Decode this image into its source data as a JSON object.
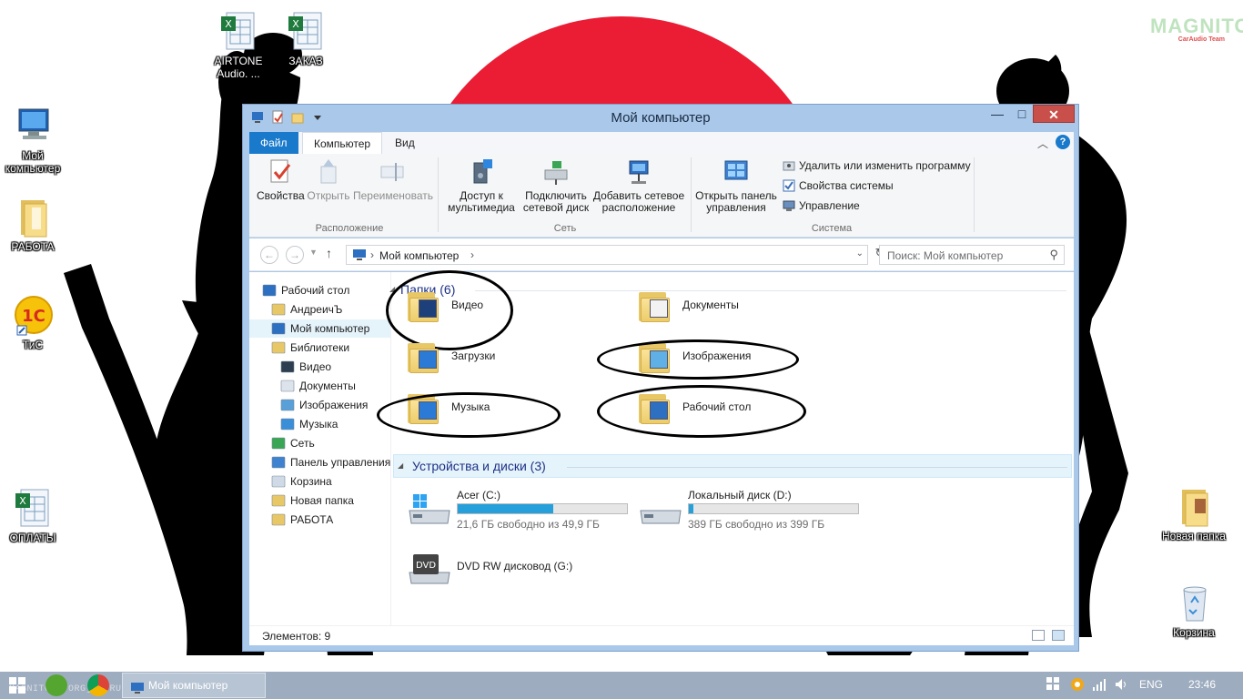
{
  "desktop": {
    "icons": [
      {
        "label": "AIRTONE\nAudio. ...",
        "icon": "excel-file-icon"
      },
      {
        "label": "ЗАКАЗ",
        "icon": "excel-file-icon"
      },
      {
        "label": "Мой\nкомпьютер",
        "icon": "computer-icon"
      },
      {
        "label": "РАБОТА",
        "icon": "folder-icon"
      },
      {
        "label": "ТиС",
        "icon": "1c-icon"
      },
      {
        "label": "ОПЛАТЫ",
        "icon": "excel-file-icon"
      },
      {
        "label": "Новая папка",
        "icon": "folder-icon"
      },
      {
        "label": "Корзина",
        "icon": "recycle-bin-icon"
      }
    ],
    "logo": {
      "main": "MAGNITOLA",
      "sub": "CarAudio Team"
    },
    "wallpaper_colors": {
      "sun": "#ea1d35",
      "silhouette": "#000000"
    }
  },
  "window": {
    "title": "Мой компьютер",
    "controls": {
      "minimize": "—",
      "maximize": "□",
      "close": "✕"
    },
    "ribbon": {
      "tabs": [
        "Файл",
        "Компьютер",
        "Вид"
      ],
      "groups": [
        {
          "label": "Расположение",
          "buttons": [
            "Свойства",
            "Открыть",
            "Переименовать"
          ]
        },
        {
          "label": "Сеть",
          "buttons": [
            "Доступ к\nмультимедиа",
            "Подключить\nсетевой диск",
            "Добавить сетевое\nрасположение"
          ]
        },
        {
          "label": "Система",
          "buttons": [
            "Открыть панель\nуправления"
          ],
          "small": [
            "Удалить или изменить программу",
            "Свойства системы",
            "Управление"
          ]
        }
      ]
    },
    "address": {
      "crumbs": [
        "Мой компьютер"
      ],
      "search_placeholder": "Поиск: Мой компьютер"
    },
    "nav_pane": [
      {
        "label": "Рабочий стол",
        "icon": "desktop-icon",
        "level": 0
      },
      {
        "label": "АндреичЪ",
        "icon": "user-folder-icon",
        "level": 1
      },
      {
        "label": "Мой компьютер",
        "icon": "computer-icon",
        "level": 1,
        "selected": true
      },
      {
        "label": "Библиотеки",
        "icon": "libraries-icon",
        "level": 1
      },
      {
        "label": "Видео",
        "icon": "video-icon",
        "level": 2
      },
      {
        "label": "Документы",
        "icon": "documents-icon",
        "level": 2
      },
      {
        "label": "Изображения",
        "icon": "pictures-icon",
        "level": 2
      },
      {
        "label": "Музыка",
        "icon": "music-icon",
        "level": 2
      },
      {
        "label": "Сеть",
        "icon": "network-icon",
        "level": 1
      },
      {
        "label": "Панель управления",
        "icon": "control-panel-icon",
        "level": 1
      },
      {
        "label": "Корзина",
        "icon": "recycle-bin-icon",
        "level": 1
      },
      {
        "label": "Новая папка",
        "icon": "folder-icon",
        "level": 1
      },
      {
        "label": "РАБОТА",
        "icon": "folder-icon",
        "level": 1
      }
    ],
    "folders_header": "Папки (6)",
    "folders": [
      {
        "name": "Видео",
        "icon": "video-folder-icon",
        "circled": true
      },
      {
        "name": "Документы",
        "icon": "documents-folder-icon",
        "circled": false
      },
      {
        "name": "Загрузки",
        "icon": "downloads-folder-icon",
        "circled": false
      },
      {
        "name": "Изображения",
        "icon": "pictures-folder-icon",
        "circled": true
      },
      {
        "name": "Музыка",
        "icon": "music-folder-icon",
        "circled": true
      },
      {
        "name": "Рабочий стол",
        "icon": "desktop-folder-icon",
        "circled": true
      }
    ],
    "devices_header": "Устройства и диски (3)",
    "drives": [
      {
        "name": "Acer (C:)",
        "free": "21,6 ГБ свободно из 49,9 ГБ",
        "used_fraction": 0.567
      },
      {
        "name": "Локальный диск (D:)",
        "free": "389 ГБ свободно из 399 ГБ",
        "used_fraction": 0.025
      },
      {
        "name": "DVD RW дисковод (G:)",
        "free": null,
        "used_fraction": null
      }
    ],
    "status": "Элементов: 9"
  },
  "taskbar": {
    "task_label": "Мой компьютер",
    "watermark": "MAGNITOLA.ORG] [.RU] [.NET]",
    "language": "ENG",
    "clock": "23:46"
  }
}
